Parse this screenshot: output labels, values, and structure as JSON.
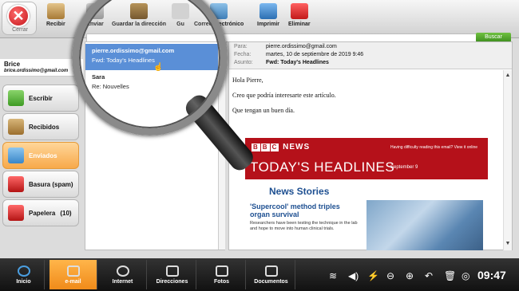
{
  "toolbar": {
    "close_label": "Cerrar",
    "buttons": [
      {
        "label": "Recibir",
        "icon": "inbox-download-icon"
      },
      {
        "label": "Enviar",
        "icon": "send-icon"
      },
      {
        "label": "Guardar la dirección",
        "icon": "save-address-icon"
      },
      {
        "label": "Gu",
        "icon": "save-icon"
      },
      {
        "label": "Correo electrónico",
        "icon": "email-icon"
      },
      {
        "label": "Imprimir",
        "icon": "printer-icon"
      },
      {
        "label": "Eliminar",
        "icon": "trash-icon"
      }
    ]
  },
  "search": {
    "button_label": "Buscar"
  },
  "account": {
    "name": "Brice",
    "email": "brice.ordissimo@gmail.com"
  },
  "sidebar": {
    "items": [
      {
        "label": "Escribir",
        "icon": "compose-icon",
        "count": ""
      },
      {
        "label": "Recibidos",
        "icon": "inbox-icon",
        "count": ""
      },
      {
        "label": "Enviados",
        "icon": "sent-icon",
        "count": ""
      },
      {
        "label": "Basura (spam)",
        "icon": "spam-icon",
        "count": ""
      },
      {
        "label": "Papelera",
        "icon": "trash-folder-icon",
        "count": "(10)"
      }
    ]
  },
  "messages": [
    {
      "from": "pierre.ordissimo@gmail.com",
      "subject": "Fwd: Today's Headlines",
      "selected": true
    },
    {
      "from": "Sara",
      "subject": "Re: Nouvelles",
      "selected": false
    }
  ],
  "reader": {
    "labels": {
      "to": "Para:",
      "date": "Fecha:",
      "subject": "Asunto:"
    },
    "to": "pierre.ordissimo@gmail.com",
    "date": "martes, 10 de septiembre de 2019 9:46",
    "subject": "Fwd: Today's Headlines",
    "paragraphs": [
      "Hola Pierre,",
      "Creo que podría interesarte este artículo.",
      "Que tengan un buen día."
    ],
    "newsletter": {
      "brand": "NEWS",
      "help": "Having difficulty reading this email? View it online",
      "headline": "TODAY'S HEADLINES",
      "date": "September 9",
      "section": "News Stories",
      "story_title": "'Supercool' method triples organ survival",
      "story_text": "Researchers have been testing the technique in the lab and hope to move into human clinical trials."
    }
  },
  "taskbar": {
    "items": [
      {
        "label": "Inicio",
        "icon": "home-icon"
      },
      {
        "label": "e-mail",
        "icon": "mail-icon"
      },
      {
        "label": "Internet",
        "icon": "globe-icon"
      },
      {
        "label": "Direcciones",
        "icon": "contacts-icon"
      },
      {
        "label": "Fotos",
        "icon": "camera-icon"
      },
      {
        "label": "Documentos",
        "icon": "documents-icon"
      }
    ],
    "clock": "09:47"
  },
  "colors": {
    "selected": "#4c86d4",
    "active_folder": "#f7a94a",
    "bbc_red": "#b5111a",
    "close_red": "#c4161c"
  }
}
